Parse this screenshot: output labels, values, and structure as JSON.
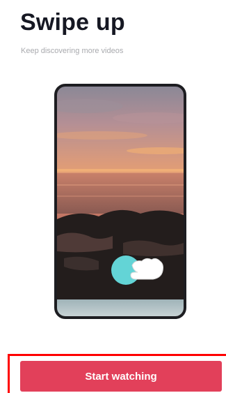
{
  "onboarding": {
    "title": "Swipe up",
    "subtitle": "Keep discovering more videos"
  },
  "illustration": {
    "scene": "sunset-over-sea",
    "gesture_icon": "swipe-up-hand-icon"
  },
  "cta": {
    "label": "Start watching",
    "color": "#e2405a"
  },
  "colors": {
    "title": "#161823",
    "subtitle": "#a9aaae",
    "highlight_outline": "#ff0000",
    "gesture_circle": "#63d4d6"
  }
}
